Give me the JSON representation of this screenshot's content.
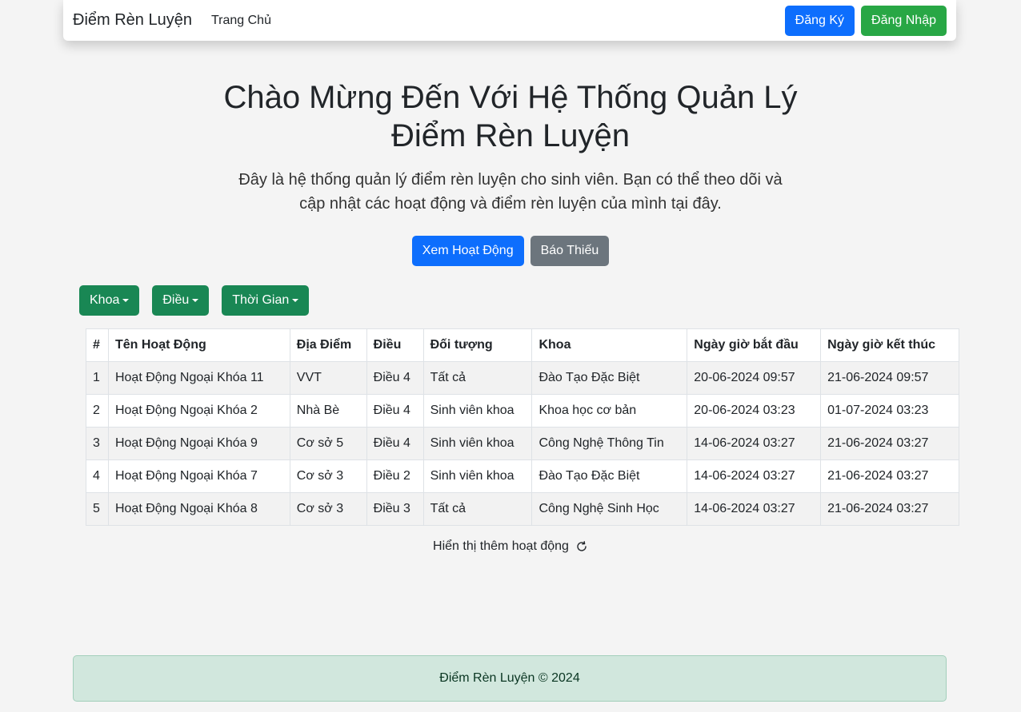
{
  "navbar": {
    "brand": "Điểm Rèn Luyện",
    "home_link": "Trang Chủ",
    "register_label": "Đăng Ký",
    "login_label": "Đăng Nhập"
  },
  "hero": {
    "title_line1": "Chào Mừng Đến Với Hệ Thống Quản Lý",
    "title_line2": "Điểm Rèn Luyện",
    "lead_line1": "Đây là hệ thống quản lý điểm rèn luyện cho sinh viên. Bạn có thể theo dõi và",
    "lead_line2": "cập nhật các hoạt động và điểm rèn luyện của mình tại đây.",
    "view_activities_label": "Xem Hoạt Động",
    "report_missing_label": "Báo Thiếu"
  },
  "filters": {
    "faculty_label": "Khoa",
    "article_label": "Điều",
    "time_label": "Thời Gian"
  },
  "table": {
    "headers": [
      "#",
      "Tên Hoạt Động",
      "Địa Điểm",
      "Điều",
      "Đối tượng",
      "Khoa",
      "Ngày giờ bắt đầu",
      "Ngày giờ kết thúc"
    ],
    "rows": [
      [
        "1",
        "Hoạt Động Ngoại Khóa 11",
        "VVT",
        "Điều 4",
        "Tất cả",
        "Đào Tạo Đặc Biệt",
        "20-06-2024 09:57",
        "21-06-2024 09:57"
      ],
      [
        "2",
        "Hoạt Động Ngoại Khóa 2",
        "Nhà Bè",
        "Điều 4",
        "Sinh viên khoa",
        "Khoa học cơ bản",
        "20-06-2024 03:23",
        "01-07-2024 03:23"
      ],
      [
        "3",
        "Hoạt Động Ngoại Khóa 9",
        "Cơ sở 5",
        "Điều 4",
        "Sinh viên khoa",
        "Công Nghệ Thông Tin",
        "14-06-2024 03:27",
        "21-06-2024 03:27"
      ],
      [
        "4",
        "Hoạt Động Ngoại Khóa 7",
        "Cơ sở 3",
        "Điều 2",
        "Sinh viên khoa",
        "Đào Tạo Đặc Biệt",
        "14-06-2024 03:27",
        "21-06-2024 03:27"
      ],
      [
        "5",
        "Hoạt Động Ngoại Khóa 8",
        "Cơ sở 3",
        "Điều 3",
        "Tất cả",
        "Công Nghệ Sinh Học",
        "14-06-2024 03:27",
        "21-06-2024 03:27"
      ]
    ]
  },
  "load_more": {
    "label": "Hiển thị thêm hoạt động",
    "icon": "refresh-icon"
  },
  "footer": {
    "text": "Điểm Rèn Luyện © 2024"
  },
  "colors": {
    "primary": "#0d6efd",
    "success": "#28a745",
    "secondary": "#6c757d",
    "filter_green": "#198754",
    "footer_bg": "#d1e7dd"
  }
}
